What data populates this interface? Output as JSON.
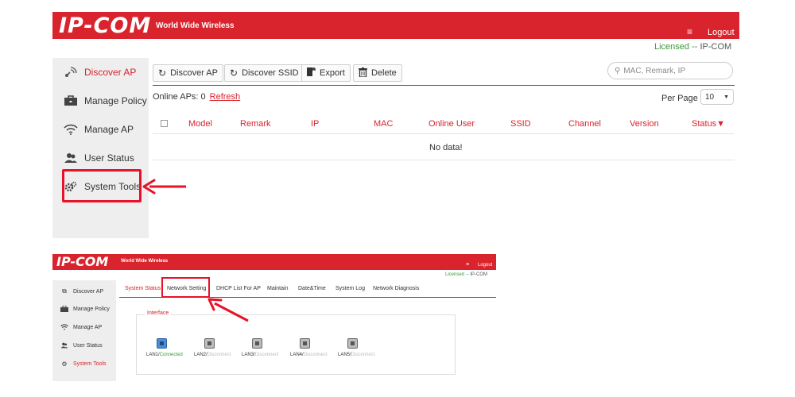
{
  "panel1": {
    "brand": "IP-COM",
    "tagline": "World Wide Wireless",
    "menu_icon": "menu-icon",
    "logout": "Logout",
    "licensed": "Licensed",
    "licensed_sep": " -- ",
    "licensed_to": "IP-COM",
    "sidebar": [
      {
        "label": "Discover AP",
        "icon": "discover-ap-icon"
      },
      {
        "label": "Manage Policy",
        "icon": "briefcase-icon"
      },
      {
        "label": "Manage AP",
        "icon": "wifi-icon"
      },
      {
        "label": "User Status",
        "icon": "users-icon"
      },
      {
        "label": "System Tools",
        "icon": "gear-icon"
      }
    ],
    "toolbar": {
      "discover_ap": "Discover AP",
      "discover_ssid": "Discover SSID",
      "export": "Export",
      "delete": "Delete"
    },
    "search_placeholder": "MAC, Remark, IP",
    "online_aps": "Online APs: 0",
    "refresh": "Refresh",
    "per_page": "Per Page",
    "per_page_value": "10",
    "columns": [
      "Model",
      "Remark",
      "IP",
      "MAC",
      "Online User",
      "SSID",
      "Channel",
      "Version",
      "Status▼"
    ],
    "no_data": "No data!"
  },
  "panel2": {
    "brand": "IP-COM",
    "tagline": "World Wide Wireless",
    "logout": "Logout",
    "licensed": "Licensed",
    "licensed_sep": " -- ",
    "licensed_to": "IP-COM",
    "sidebar": [
      {
        "label": "Discover AP"
      },
      {
        "label": "Manage Policy"
      },
      {
        "label": "Manage AP"
      },
      {
        "label": "User Status"
      },
      {
        "label": "System Tools"
      }
    ],
    "tabs": [
      "System Status",
      "Network Setting",
      "DHCP List For AP",
      "Maintain",
      "Date&Time",
      "System Log",
      "Network Diagnosis"
    ],
    "interface_legend": "Interface",
    "ports": [
      {
        "name": "LAN1",
        "status": "Connected",
        "connected": true
      },
      {
        "name": "LAN2",
        "status": "Disconnect",
        "connected": false
      },
      {
        "name": "LAN3",
        "status": "Disconnect",
        "connected": false
      },
      {
        "name": "LAN4",
        "status": "Disconnect",
        "connected": false
      },
      {
        "name": "LAN5",
        "status": "Disconnect",
        "connected": false
      }
    ]
  },
  "colors": {
    "brand_red": "#d9232d",
    "highlight_red": "#e8112a",
    "connected_green": "#3a9a3a"
  }
}
